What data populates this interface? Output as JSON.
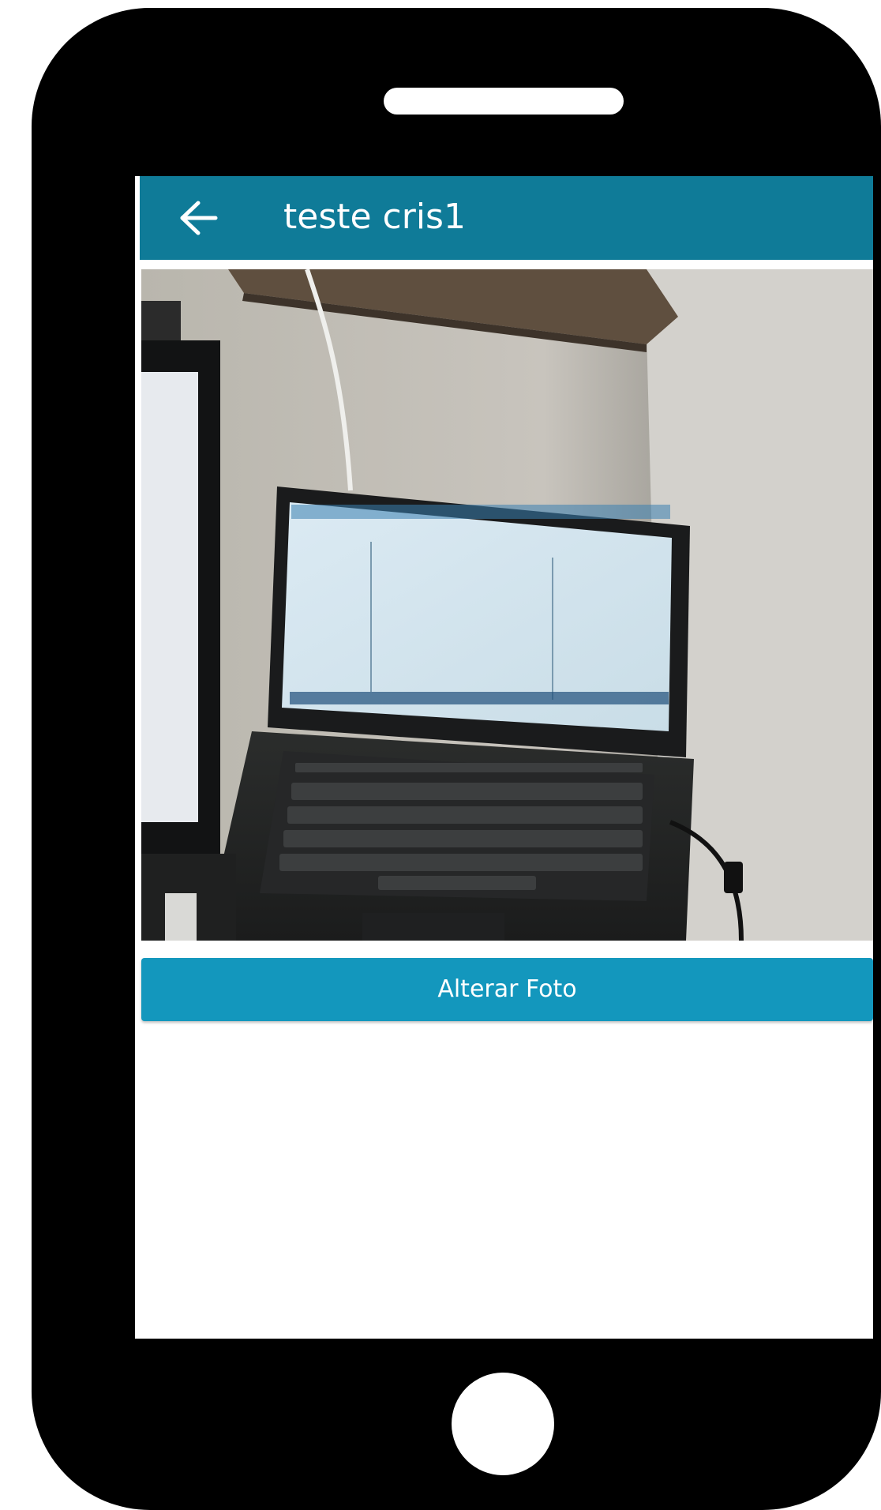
{
  "app_bar": {
    "title": "teste cris1",
    "back_icon": "arrow-left-icon",
    "color": "#0f7b98"
  },
  "photo": {
    "subject": "laptop on desk"
  },
  "actions": {
    "change_photo_label": "Alterar Foto",
    "color": "#1397bd"
  },
  "device": {
    "frame_color": "#000000"
  }
}
